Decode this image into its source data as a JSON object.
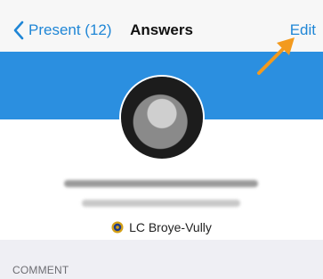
{
  "nav": {
    "back_label": "Present (12)",
    "title": "Answers",
    "edit_label": "Edit"
  },
  "profile": {
    "club_name": "LC Broye-Vully"
  },
  "sections": {
    "comment_header": "COMMENT"
  },
  "colors": {
    "accent": "#1f86d6",
    "banner": "#2b8fe0",
    "annotation_arrow": "#f39a1e"
  }
}
